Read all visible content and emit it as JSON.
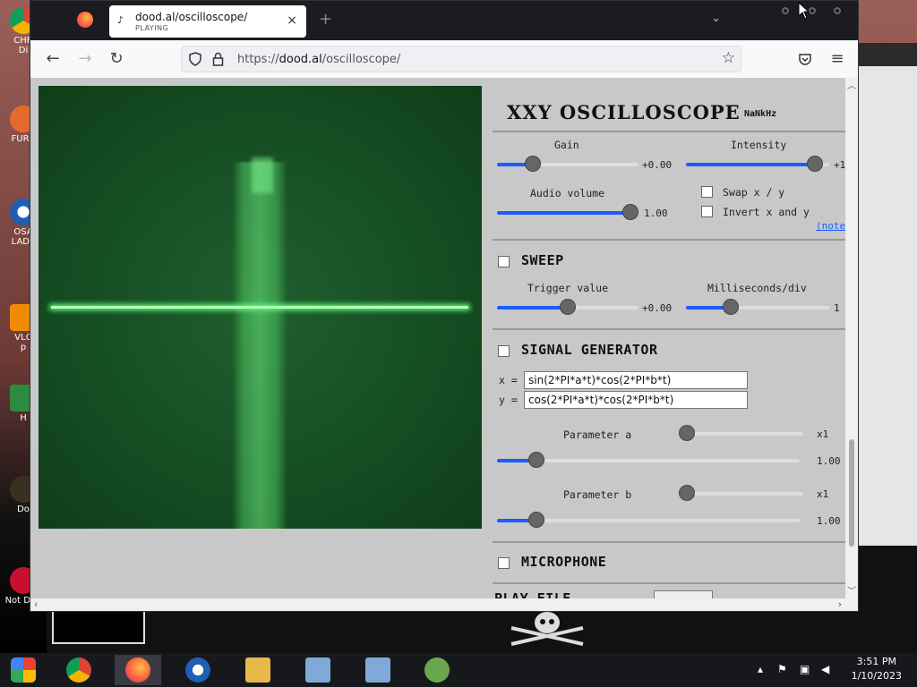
{
  "desktop": {
    "icons": [
      {
        "label": "CHR\nDi"
      },
      {
        "label": "FURR"
      },
      {
        "label": "OSA\nLADE"
      },
      {
        "label": "VLC\np"
      },
      {
        "label": "H"
      },
      {
        "label": "Do"
      },
      {
        "label": "Not Dog"
      }
    ]
  },
  "browser": {
    "tab": {
      "title": "dood.al/oscilloscope/",
      "status": "PLAYING",
      "close": "×"
    },
    "new_tab": "+",
    "url_prefix": "https://",
    "url_domain": "dood.al",
    "url_path": "/oscilloscope/"
  },
  "panel": {
    "title": "XXY OSCILLOSCOPE",
    "freq": "NaNkHz",
    "gain": {
      "label": "Gain",
      "value": "+0.00",
      "fraction": 0.25
    },
    "intensity": {
      "label": "Intensity",
      "value": "+1",
      "fraction": 0.9
    },
    "audio_volume": {
      "label": "Audio volume",
      "value": "1.00",
      "fraction": 0.94
    },
    "swap_xy": {
      "label": "Swap x / y",
      "checked": false
    },
    "invert_xy": {
      "label": "Invert x and y",
      "checked": false
    },
    "note": "(note",
    "sweep": {
      "label": "SWEEP",
      "checked": false
    },
    "trigger": {
      "label": "Trigger value",
      "value": "+0.00",
      "fraction": 0.5
    },
    "ms_div": {
      "label": "Milliseconds/div",
      "value": "1",
      "fraction": 0.31
    },
    "signal_generator": {
      "label": "SIGNAL GENERATOR",
      "checked": false
    },
    "x_label": "x =",
    "y_label": "y =",
    "x_formula": "sin(2*PI*a*t)*cos(2*PI*b*t)",
    "y_formula": "cos(2*PI*a*t)*cos(2*PI*b*t)",
    "param_a": {
      "label": "Parameter a",
      "mult": "x1",
      "value": "1.00",
      "mult_fraction": 0.0,
      "fraction": 0.13
    },
    "param_b": {
      "label": "Parameter b",
      "mult": "x1",
      "value": "1.00",
      "mult_fraction": 0.0,
      "fraction": 0.13
    },
    "microphone": {
      "label": "MICROPHONE",
      "checked": false
    },
    "play_file": {
      "label": "PLAY FILE"
    }
  },
  "taskbar": {
    "time": "3:51 PM",
    "date": "1/10/2023"
  },
  "colors": {
    "accent": "#1a5cff",
    "scope_bg": "#154c22",
    "beam": "#b8ffbf"
  }
}
